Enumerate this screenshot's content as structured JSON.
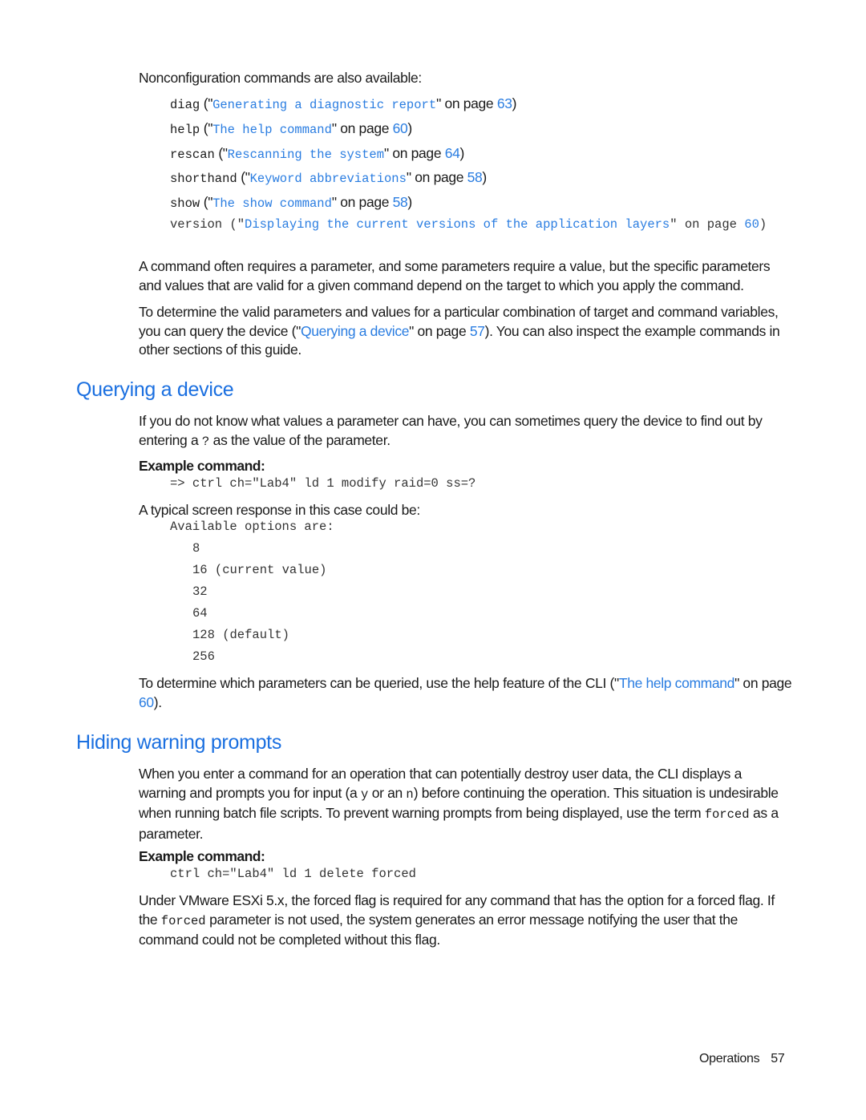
{
  "intro": "Nonconfiguration commands are also available:",
  "commands": [
    {
      "cmd": "diag",
      "link": "Generating a diagnostic report",
      "page": "63"
    },
    {
      "cmd": "help",
      "link": "The help command",
      "page": "60"
    },
    {
      "cmd": "rescan",
      "link": "Rescanning the system",
      "page": "64"
    },
    {
      "cmd": "shorthand",
      "link": "Keyword abbreviations",
      "page": "58"
    },
    {
      "cmd": "show",
      "link": "The show command",
      "page": "58"
    }
  ],
  "version_cmd": {
    "cmd": "version",
    "link": "Displaying the current versions of the application layers",
    "on_page": "on page",
    "page": "60"
  },
  "on_page": "on page",
  "para1": "A command often requires a parameter, and some parameters require a value, but the specific parameters and values that are valid for a given command depend on the target to which you apply the command.",
  "para2": {
    "before": "To determine the valid parameters and values for a particular combination of target and command variables, you can query the device (\"",
    "link": "Querying a device",
    "mid": "\" on page ",
    "page": "57",
    "after": "). You can also inspect the example commands in other sections of this guide."
  },
  "section1": {
    "title": "Querying a device",
    "para_before": "If you do not know what values a parameter can have, you can sometimes query the device to find out by entering a ",
    "para_code": "?",
    "para_after": " as the value of the parameter.",
    "example_label": "Example command:",
    "example_code": "=> ctrl ch=\"Lab4\" ld 1 modify raid=0 ss=?",
    "response_label": "A typical screen response in this case could be:",
    "response_header": "Available options are:",
    "options": [
      "8",
      "16 (current value)",
      "32",
      "64",
      "128 (default)",
      "256"
    ],
    "closing_before": "To determine which parameters can be queried, use the help feature of the CLI (\"",
    "closing_link": "The help command",
    "closing_mid": "\" on page ",
    "closing_page": "60",
    "closing_after": ")."
  },
  "section2": {
    "title": "Hiding warning prompts",
    "p1_a": "When you enter a command for an operation that can potentially destroy user data, the CLI displays a warning and prompts you for input (a ",
    "p1_y": "y",
    "p1_b": " or an ",
    "p1_n": "n",
    "p1_c": ") before continuing the operation. This situation is undesirable when running batch file scripts. To prevent warning prompts from being displayed, use the term ",
    "p1_forced": "forced",
    "p1_d": " as a parameter.",
    "example_label": "Example command:",
    "example_code": "ctrl ch=\"Lab4\" ld 1 delete forced",
    "p2_a": "Under VMware ESXi 5.x, the forced flag is required for any command that has the option for a forced flag. If the ",
    "p2_forced": "forced",
    "p2_b": " parameter is not used, the system generates an error message notifying the user that the command could not be completed without this flag."
  },
  "footer": {
    "section": "Operations",
    "page_number": "57"
  }
}
